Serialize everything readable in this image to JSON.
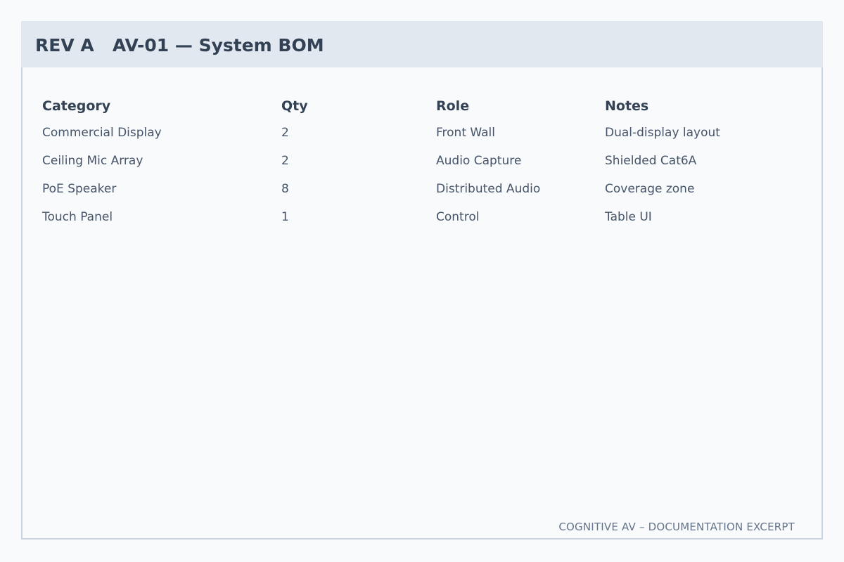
{
  "header": {
    "title": "REV A   AV-01 — System BOM"
  },
  "table": {
    "columns": [
      "Category",
      "Qty",
      "Role",
      "Notes"
    ],
    "rows": [
      [
        "Commercial Display",
        "2",
        "Front Wall",
        "Dual-display layout"
      ],
      [
        "Ceiling Mic Array",
        "2",
        "Audio Capture",
        "Shielded Cat6A"
      ],
      [
        "PoE Speaker",
        "8",
        "Distributed Audio",
        "Coverage zone"
      ],
      [
        "Touch Panel",
        "1",
        "Control",
        "Table UI"
      ]
    ]
  },
  "footer": {
    "text": "COGNITIVE AV – DOCUMENTATION EXCERPT"
  },
  "colors": {
    "background": "#f8fafc",
    "header_bg": "#e2e8f0",
    "border": "#cbd5e1",
    "heading_text": "#334155",
    "body_text": "#475569",
    "footer_text": "#64748b"
  }
}
